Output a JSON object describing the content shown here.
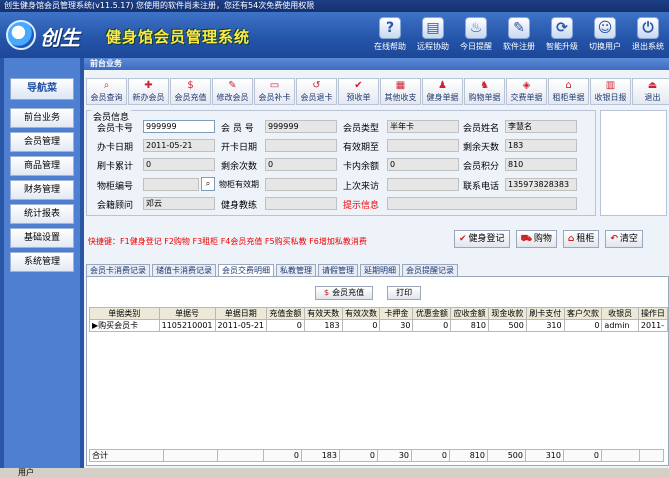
{
  "window": {
    "title": "创生健身馆会员管理系统(v11.5.17)  您使用的软件尚未注册，您还有54次免费使用权限"
  },
  "brand": {
    "logo_text": "创生",
    "system_name": "健身馆会员管理系统"
  },
  "top_buttons": [
    {
      "label": "在线帮助",
      "icon": "?"
    },
    {
      "label": "远程协助",
      "icon": "▤"
    },
    {
      "label": "今日提醒",
      "icon": "♨"
    },
    {
      "label": "软件注册",
      "icon": "✎"
    },
    {
      "label": "智能升级",
      "icon": "⟳"
    },
    {
      "label": "切换用户",
      "icon": "☺"
    },
    {
      "label": "退出系统",
      "icon": "⏻"
    }
  ],
  "nav": {
    "header": "导航菜",
    "items": [
      "前台业务",
      "会员管理",
      "商品管理",
      "财务管理",
      "统计报表",
      "基础设置",
      "系统管理"
    ]
  },
  "section_title": "前台业务",
  "toolbar": [
    {
      "label": "会员查询",
      "icon": "⌕"
    },
    {
      "label": "新办会员",
      "icon": "✚"
    },
    {
      "label": "会员充值",
      "icon": "$"
    },
    {
      "label": "修改会员",
      "icon": "✎"
    },
    {
      "label": "会员补卡",
      "icon": "▭"
    },
    {
      "label": "会员退卡",
      "icon": "↺"
    },
    {
      "label": "预收单",
      "icon": "✔"
    },
    {
      "label": "其他收支",
      "icon": "▦"
    },
    {
      "label": "健身单据",
      "icon": "♟"
    },
    {
      "label": "购物单据",
      "icon": "♞"
    },
    {
      "label": "交费单据",
      "icon": "◈"
    },
    {
      "label": "租柜单据",
      "icon": "⌂"
    },
    {
      "label": "收银日报",
      "icon": "▥"
    },
    {
      "label": "退出",
      "icon": "⏏"
    }
  ],
  "member_info": {
    "group_title": "会员信息",
    "card_no_label": "会员卡号",
    "card_no": "999999",
    "member_no_label": "会 员 号",
    "member_no": "999999",
    "type_label": "会员类型",
    "type": "半年卡",
    "name_label": "会员姓名",
    "name": "李慧名",
    "issue_date_label": "办卡日期",
    "issue_date": "2011-05-21",
    "open_date_label": "开卡日期",
    "open_date": "",
    "valid_until_label": "有效期至",
    "valid_until": "",
    "days_left_label": "剩余天数",
    "days_left": "183",
    "swipe_total_label": "刷卡累计",
    "swipe_total": "0",
    "times_left_label": "剩余次数",
    "times_left": "0",
    "balance_label": "卡内余额",
    "balance": "0",
    "points_label": "会员积分",
    "points": "810",
    "locker_no_label": "物柜编号",
    "locker_no": "",
    "locker_valid_label": "物柜有效期",
    "locker_valid": "",
    "last_visit_label": "上次来访",
    "last_visit": "",
    "phone_label": "联系电话",
    "phone": "13597382838​3",
    "advisor_label": "会籍顾问",
    "advisor": "邓云",
    "coach_label": "健身教练",
    "coach": "",
    "notice_label": "提示信息",
    "notice": ""
  },
  "hotkeys": "快捷键：F1健身登记   F2购物   F3租柜   F4会员充值   F5购买私教   F6增加私教消费",
  "action_buttons": [
    {
      "label": "健身登记",
      "icon": "✔"
    },
    {
      "label": "购物",
      "icon": "⛟"
    },
    {
      "label": "租柜",
      "icon": "⌂"
    },
    {
      "label": "清空",
      "icon": "↶"
    }
  ],
  "tabs": [
    "会员卡消费记录",
    "储值卡消费记录",
    "会员交费明细",
    "私教管理",
    "请假管理",
    "延期明细",
    "会员提醒记录"
  ],
  "active_tab": 2,
  "panel_buttons": {
    "recharge": "会员充值",
    "print": "打印"
  },
  "grid": {
    "columns": [
      "单据类别",
      "单据号",
      "单据日期",
      "充值金额",
      "有效天数",
      "有效次数",
      "卡押金",
      "优惠金额",
      "应收金额",
      "现金收款",
      "刷卡支付",
      "客户欠款",
      "收银员",
      "操作日"
    ],
    "rows": [
      [
        "购买会员卡",
        "1105210001",
        "2011-05-21",
        "0",
        "183",
        "0",
        "30",
        "0",
        "810",
        "500",
        "310",
        "0",
        "admin",
        "2011-"
      ]
    ],
    "totals": [
      "合计",
      "",
      "",
      "0",
      "183",
      "0",
      "30",
      "0",
      "810",
      "500",
      "310",
      "0",
      "",
      ""
    ]
  },
  "status_bar": "用户"
}
